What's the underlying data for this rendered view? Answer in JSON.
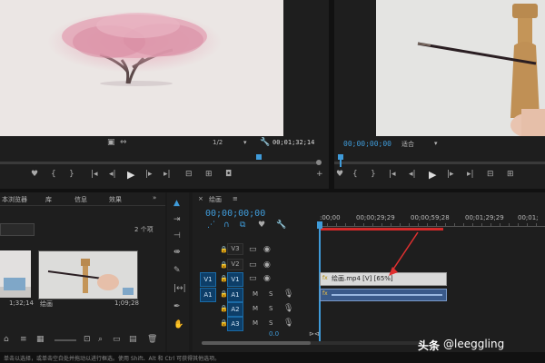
{
  "colors": {
    "accent": "#3f9bd9",
    "playhead": "#3f9bd9",
    "render_bar": "#d42a2a",
    "annotation_arrow": "#e03030",
    "video_clip": "#d9d9d9",
    "audio_clip": "#3a5a8a",
    "panel_bg": "#1e1e1e"
  },
  "source_monitor": {
    "zoom_value": "1/2",
    "timecode": "00;01;32;14",
    "wrench_icon": "wrench-icon"
  },
  "program_monitor": {
    "timecode": "00;00;00;00",
    "fit_value": "适合"
  },
  "transport_buttons": [
    "marker-icon",
    "in-point-icon",
    "out-point-icon",
    "go-to-in-icon",
    "step-back-icon",
    "play-icon",
    "step-forward-icon",
    "go-to-out-icon",
    "insert-icon",
    "overwrite-icon",
    "camera-icon",
    "add-button-icon"
  ],
  "project_panel": {
    "tabs": [
      "本浏览器",
      "库",
      "信息",
      "效果"
    ],
    "more": "»",
    "item_count": "2 个项",
    "items": [
      {
        "name": "",
        "duration": "1;32;14"
      },
      {
        "name": "绘画",
        "duration": "1;09;28"
      }
    ]
  },
  "timeline": {
    "tab_label": "绘画",
    "tab_menu": "≡",
    "timecode": "00;00;00;00",
    "ruler_labels": [
      ":00;00",
      "00;00;29;29",
      "00;00;59;28",
      "00;01;29;29",
      "00;01;"
    ],
    "tracks": [
      {
        "name": "V3",
        "type": "video"
      },
      {
        "name": "V2",
        "type": "video"
      },
      {
        "name": "V1",
        "type": "video",
        "source": "V1"
      },
      {
        "name": "A1",
        "type": "audio",
        "source": "A1",
        "m": "M",
        "s": "S"
      },
      {
        "name": "A2",
        "type": "audio",
        "m": "M",
        "s": "S"
      },
      {
        "name": "A3",
        "type": "audio",
        "m": "M",
        "s": "S"
      }
    ],
    "master_value": "0.0",
    "video_clip_label": "绘画.mp4 [V] [65%]",
    "fx_badge": "fx"
  },
  "status_bar": "单击以选择，或单击空白处并拖动以进行框选。使用 Shift、Alt 和 Ctrl 可获得其他选项。",
  "watermark": {
    "brand": "头条",
    "handle": "@leeggling"
  }
}
